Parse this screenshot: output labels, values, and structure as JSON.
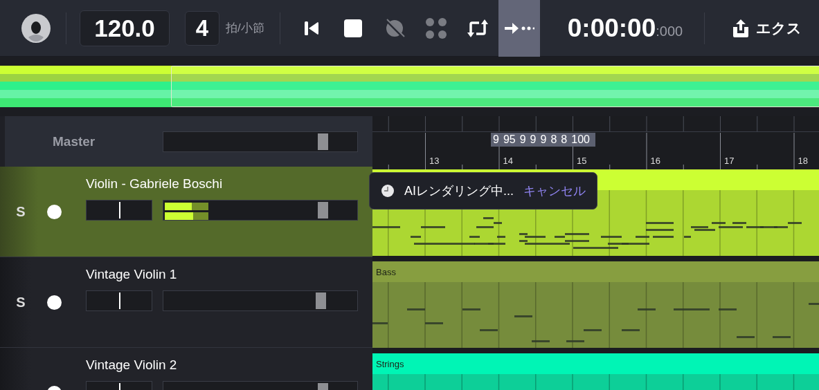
{
  "toolbar": {
    "tempo": "120.0",
    "beats": "4",
    "beats_unit": "拍/小節",
    "transport": [
      {
        "kind": "skip-back",
        "active": false,
        "disabled": false
      },
      {
        "kind": "stop",
        "active": false,
        "disabled": false
      },
      {
        "kind": "metronome",
        "active": false,
        "disabled": true
      },
      {
        "kind": "snap",
        "active": false,
        "disabled": true
      },
      {
        "kind": "loop",
        "active": false,
        "disabled": false
      },
      {
        "kind": "follow",
        "active": true,
        "disabled": false
      }
    ],
    "time": "0:00:00",
    "time_ms": ":000",
    "export_label": "エクス"
  },
  "master": {
    "label": "Master",
    "volume": {
      "level": 0.82
    }
  },
  "ruler": {
    "bars": [
      "13",
      "14",
      "15",
      "16",
      "17",
      "18"
    ],
    "tempo_markers": [
      "9",
      "95",
      "9",
      "9",
      "9",
      "8",
      "8",
      "100"
    ]
  },
  "tracks": [
    {
      "name": "Violin - Gabriele Boschi",
      "solo": "S",
      "selected": true,
      "pan": {
        "level": 0.5
      },
      "volume": {
        "level": 0.82
      },
      "meter": [
        {
          "level": 0.14,
          "peak": {
            "level": 0.23
          }
        },
        {
          "level": 0.15,
          "peak": {
            "level": 0.23
          }
        }
      ],
      "clip": {
        "color": "#ccff33",
        "kind": "violin"
      }
    },
    {
      "name": "Vintage Violin 1",
      "solo": "S",
      "selected": false,
      "pan": {
        "level": 0.5
      },
      "volume": {
        "level": 0.81
      },
      "clip": {
        "label": "Bass",
        "color": "#879e40",
        "kind": "bass"
      }
    },
    {
      "name": "Vintage Violin 2",
      "selected": false,
      "pan": {
        "level": 0.5
      },
      "volume": {
        "level": 0.82
      },
      "clip": {
        "label": "Strings",
        "color": "#00f5b5",
        "kind": "strings"
      }
    }
  ],
  "toast": {
    "message": "AIレンダリング中...",
    "action": "キャンセル"
  }
}
